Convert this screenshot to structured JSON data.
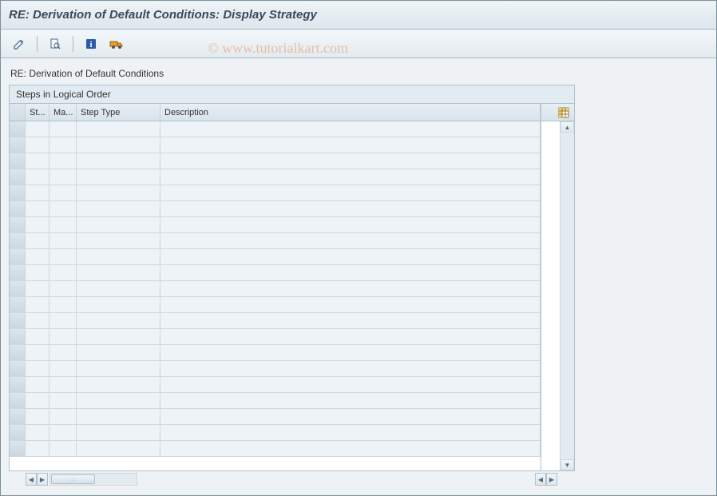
{
  "window": {
    "title": "RE: Derivation of Default Conditions: Display Strategy"
  },
  "toolbar": {
    "icons": {
      "edit": "edit-pencil-icon",
      "overview": "magnifier-doc-icon",
      "info": "info-icon",
      "transport": "truck-icon"
    }
  },
  "subtitle": "RE: Derivation of Default Conditions",
  "section": {
    "header": "Steps in Logical Order"
  },
  "columns": {
    "st": "St...",
    "ma": "Ma...",
    "type": "Step Type",
    "desc": "Description"
  },
  "rows": [
    {
      "st": "",
      "ma": "",
      "type": "",
      "desc": ""
    },
    {
      "st": "",
      "ma": "",
      "type": "",
      "desc": ""
    },
    {
      "st": "",
      "ma": "",
      "type": "",
      "desc": ""
    },
    {
      "st": "",
      "ma": "",
      "type": "",
      "desc": ""
    },
    {
      "st": "",
      "ma": "",
      "type": "",
      "desc": ""
    },
    {
      "st": "",
      "ma": "",
      "type": "",
      "desc": ""
    },
    {
      "st": "",
      "ma": "",
      "type": "",
      "desc": ""
    },
    {
      "st": "",
      "ma": "",
      "type": "",
      "desc": ""
    },
    {
      "st": "",
      "ma": "",
      "type": "",
      "desc": ""
    },
    {
      "st": "",
      "ma": "",
      "type": "",
      "desc": ""
    },
    {
      "st": "",
      "ma": "",
      "type": "",
      "desc": ""
    },
    {
      "st": "",
      "ma": "",
      "type": "",
      "desc": ""
    },
    {
      "st": "",
      "ma": "",
      "type": "",
      "desc": ""
    },
    {
      "st": "",
      "ma": "",
      "type": "",
      "desc": ""
    },
    {
      "st": "",
      "ma": "",
      "type": "",
      "desc": ""
    },
    {
      "st": "",
      "ma": "",
      "type": "",
      "desc": ""
    },
    {
      "st": "",
      "ma": "",
      "type": "",
      "desc": ""
    },
    {
      "st": "",
      "ma": "",
      "type": "",
      "desc": ""
    },
    {
      "st": "",
      "ma": "",
      "type": "",
      "desc": ""
    },
    {
      "st": "",
      "ma": "",
      "type": "",
      "desc": ""
    },
    {
      "st": "",
      "ma": "",
      "type": "",
      "desc": ""
    }
  ],
  "watermark": "© www.tutorialkart.com"
}
